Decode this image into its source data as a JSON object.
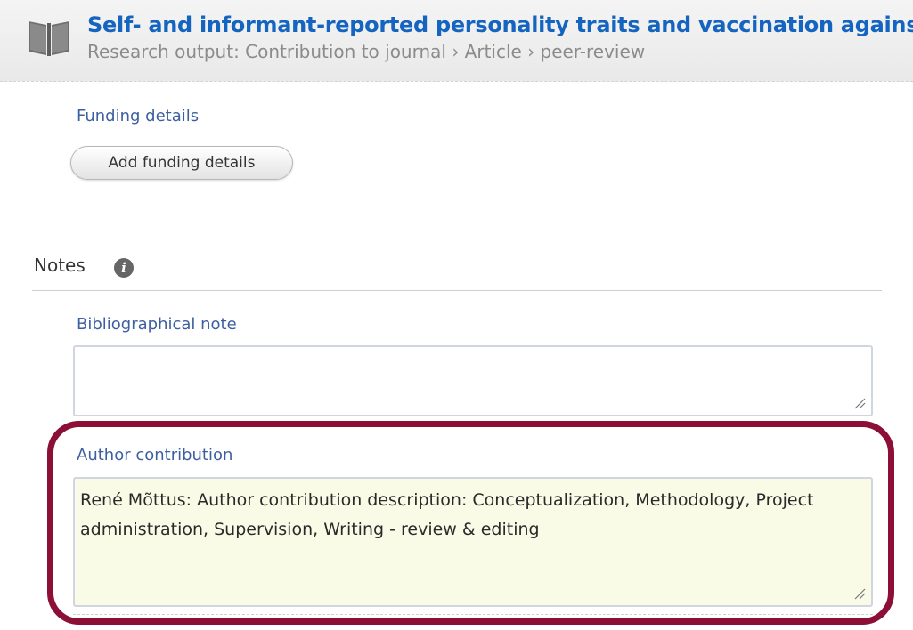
{
  "header": {
    "icon": "book-icon",
    "title": "Self- and informant-reported personality traits and vaccination against",
    "subtitle": "Research output: Contribution to journal › Article › peer-review"
  },
  "funding": {
    "label": "Funding details",
    "button_label": "Add funding details"
  },
  "notes": {
    "heading": "Notes",
    "info_icon": "info-icon",
    "bibliographical_note": {
      "label": "Bibliographical note",
      "value": ""
    },
    "author_contribution": {
      "label": "Author contribution",
      "value": "René Mõttus: Author contribution description: Conceptualization, Methodology, Project administration, Supervision, Writing - review & editing"
    }
  },
  "colors": {
    "title": "#1565c0",
    "field_label": "#3d5fa0",
    "highlight_border": "#8b0f36",
    "author_field_bg": "#fafbe6"
  }
}
